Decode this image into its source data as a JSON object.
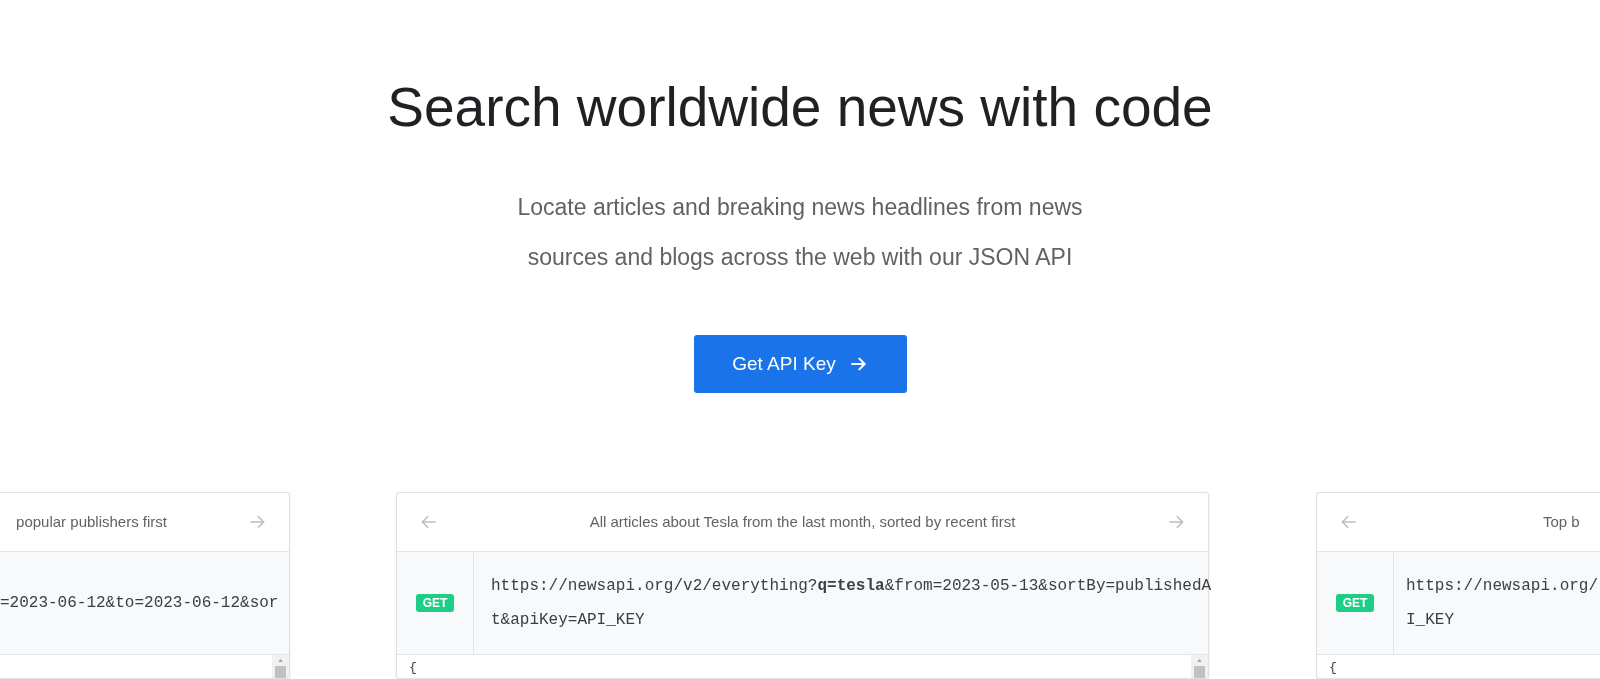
{
  "hero": {
    "title": "Search worldwide news with code",
    "subtitle": "Locate articles and breaking news headlines from news sources and blogs across the web with our JSON API",
    "button": "Get API Key"
  },
  "cards": [
    {
      "kind": "clipped_left",
      "title": "popular publishers first",
      "url": "=2023-06-12&to=2023-06-12&sor"
    },
    {
      "kind": "full",
      "title": "All articles about Tesla from the last month, sorted by recent first",
      "method": "GET",
      "url": "https://newsapi.org/v2/everything?**q=tesla**&from=2023-05-13&sortBy=publishedAt&apiKey=API_KEY",
      "code": "{"
    },
    {
      "kind": "clipped_right",
      "title": "Top b",
      "method": "GET",
      "url": "https://newsapi.org/",
      "url_line2": "I_KEY",
      "code": "{"
    }
  ]
}
